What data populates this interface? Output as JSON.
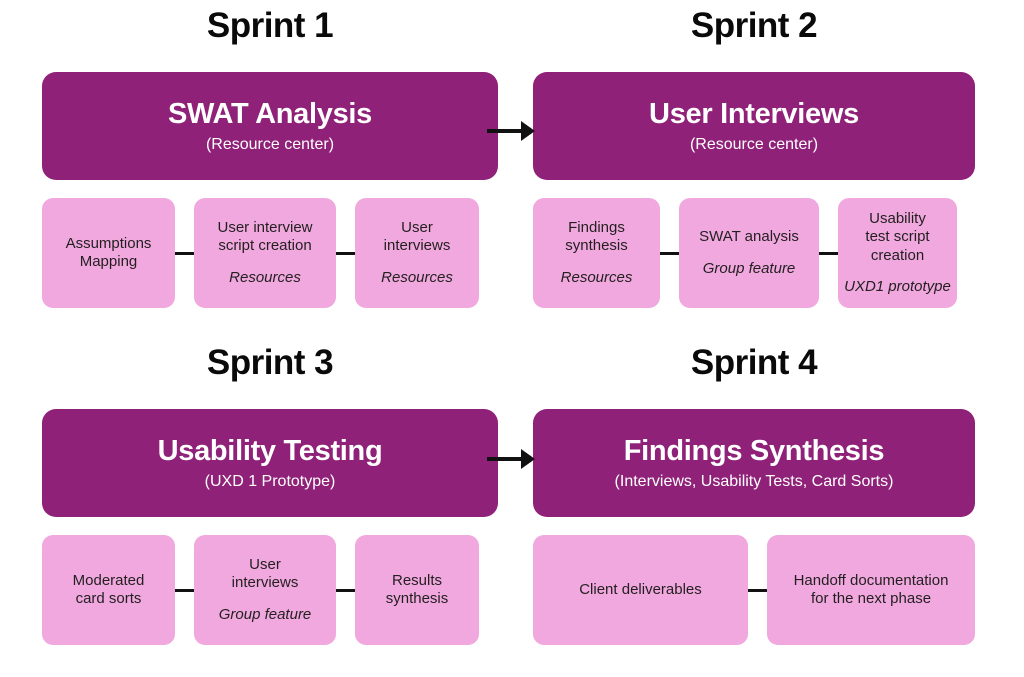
{
  "colors": {
    "main_card_bg": "#8F2178",
    "task_card_bg": "#F0A8DE",
    "main_card_text": "#FFFFFF",
    "task_card_text": "#231F20",
    "title_text": "#0A0A0A",
    "connector": "#111111",
    "page_bg": "#FFFFFF"
  },
  "sprints": [
    {
      "title": "Sprint 1",
      "main": {
        "title": "SWAT Analysis",
        "subtitle": "(Resource center)"
      },
      "tasks": [
        {
          "label": "Assumptions\nMapping",
          "note": ""
        },
        {
          "label": "User interview\nscript creation",
          "note": "Resources"
        },
        {
          "label": "User\ninterviews",
          "note": "Resources"
        }
      ]
    },
    {
      "title": "Sprint 2",
      "main": {
        "title": "User Interviews",
        "subtitle": "(Resource center)"
      },
      "tasks": [
        {
          "label": "Findings\nsynthesis",
          "note": "Resources"
        },
        {
          "label": "SWAT analysis",
          "note": "Group feature"
        },
        {
          "label": "Usability\ntest script\ncreation",
          "note": "UXD1 prototype"
        }
      ]
    },
    {
      "title": "Sprint 3",
      "main": {
        "title": "Usability Testing",
        "subtitle": "(UXD 1  Prototype)"
      },
      "tasks": [
        {
          "label": "Moderated\ncard sorts",
          "note": ""
        },
        {
          "label": "User\ninterviews",
          "note": "Group feature"
        },
        {
          "label": "Results\nsynthesis",
          "note": ""
        }
      ]
    },
    {
      "title": "Sprint 4",
      "main": {
        "title": "Findings Synthesis",
        "subtitle": "(Interviews, Usability Tests, Card Sorts)"
      },
      "tasks": [
        {
          "label": "Client deliverables",
          "note": ""
        },
        {
          "label": "Handoff documentation\nfor the next phase",
          "note": ""
        }
      ]
    }
  ],
  "arrows": [
    {
      "name": "arrow-sprint1-to-sprint2",
      "direction": "right"
    },
    {
      "name": "arrow-sprint3-to-sprint4",
      "direction": "right"
    }
  ]
}
